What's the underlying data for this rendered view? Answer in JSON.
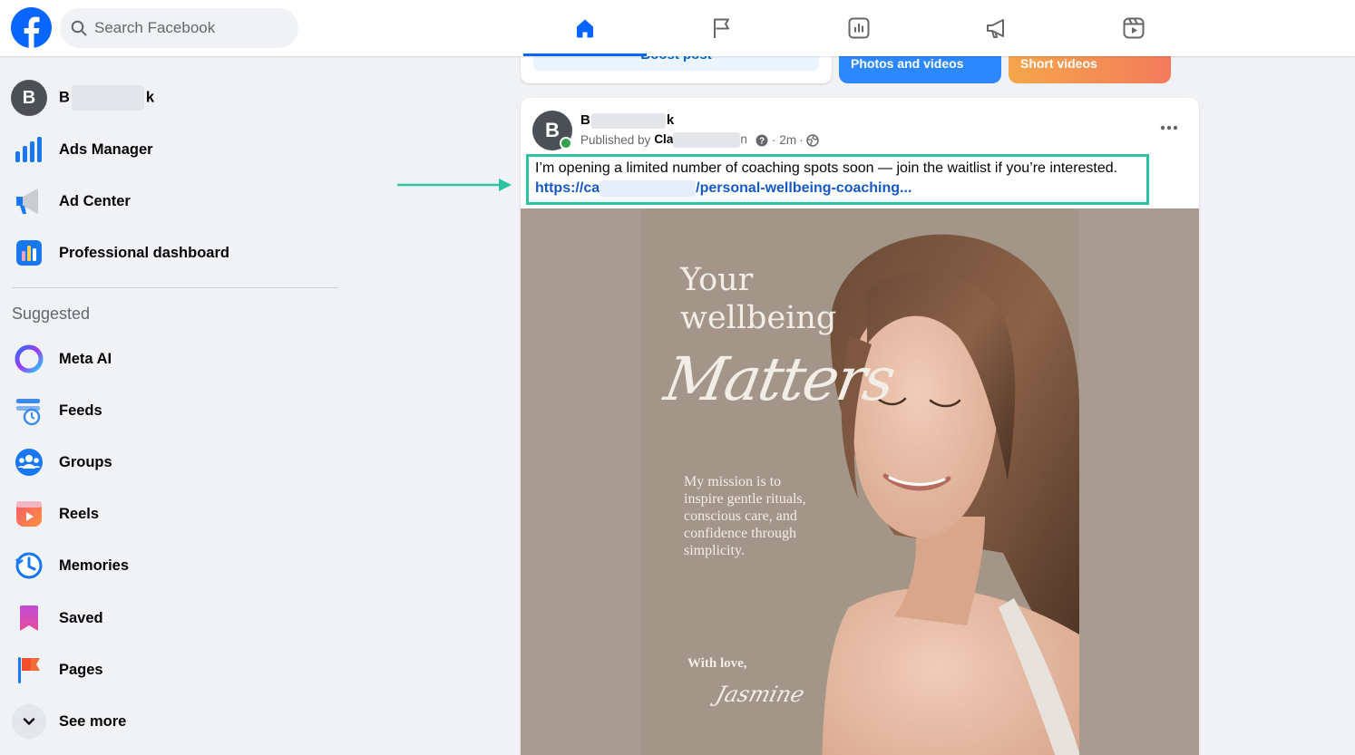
{
  "topbar": {
    "search_placeholder": "Search Facebook",
    "nav_tabs": [
      {
        "icon": "home-icon",
        "active": true
      },
      {
        "icon": "flag-icon",
        "active": false
      },
      {
        "icon": "insights-icon",
        "active": false
      },
      {
        "icon": "megaphone-icon",
        "active": false
      },
      {
        "icon": "reels-icon",
        "active": false
      }
    ]
  },
  "sidebar": {
    "profile": {
      "initial": "B",
      "name_start": "B",
      "name_end": "k"
    },
    "items": [
      {
        "label": "Ads Manager",
        "icon": "ads-manager-icon"
      },
      {
        "label": "Ad Center",
        "icon": "ad-center-icon"
      },
      {
        "label": "Professional dashboard",
        "icon": "professional-dashboard-icon"
      }
    ],
    "section_title": "Suggested",
    "suggested": [
      {
        "label": "Meta AI",
        "icon": "meta-ai-icon"
      },
      {
        "label": "Feeds",
        "icon": "feeds-icon"
      },
      {
        "label": "Groups",
        "icon": "groups-icon"
      },
      {
        "label": "Reels",
        "icon": "reels-icon"
      },
      {
        "label": "Memories",
        "icon": "memories-icon"
      },
      {
        "label": "Saved",
        "icon": "saved-icon"
      },
      {
        "label": "Pages",
        "icon": "pages-icon"
      },
      {
        "label": "See more",
        "icon": "chevron-down-icon"
      }
    ]
  },
  "composer": {
    "boost_label": "Boost post",
    "photos_label": "Photos and videos",
    "short_label": "Short videos"
  },
  "post": {
    "author_initial": "B",
    "author_start": "B",
    "author_end": "k",
    "published_by": "Published by",
    "publisher_start": "Cla",
    "publisher_end": "n",
    "time": "2m",
    "text": "I’m opening a limited number of coaching spots soon — join the waitlist if you’re interested.",
    "link_start": "https://ca",
    "link_end": "/personal-wellbeing-coaching...",
    "image": {
      "heading_line1": "Your",
      "heading_line2": "wellbeing",
      "script_word": "Matters",
      "mission": [
        "My mission is to",
        "inspire gentle rituals,",
        "conscious care, and",
        "confidence through",
        "simplicity."
      ],
      "signoff": "With love,",
      "signature": "Jasmine"
    }
  },
  "colors": {
    "brand_blue": "#0866ff",
    "highlight_border": "#2cc3a1",
    "link": "#1459c7",
    "online": "#31a24c"
  }
}
